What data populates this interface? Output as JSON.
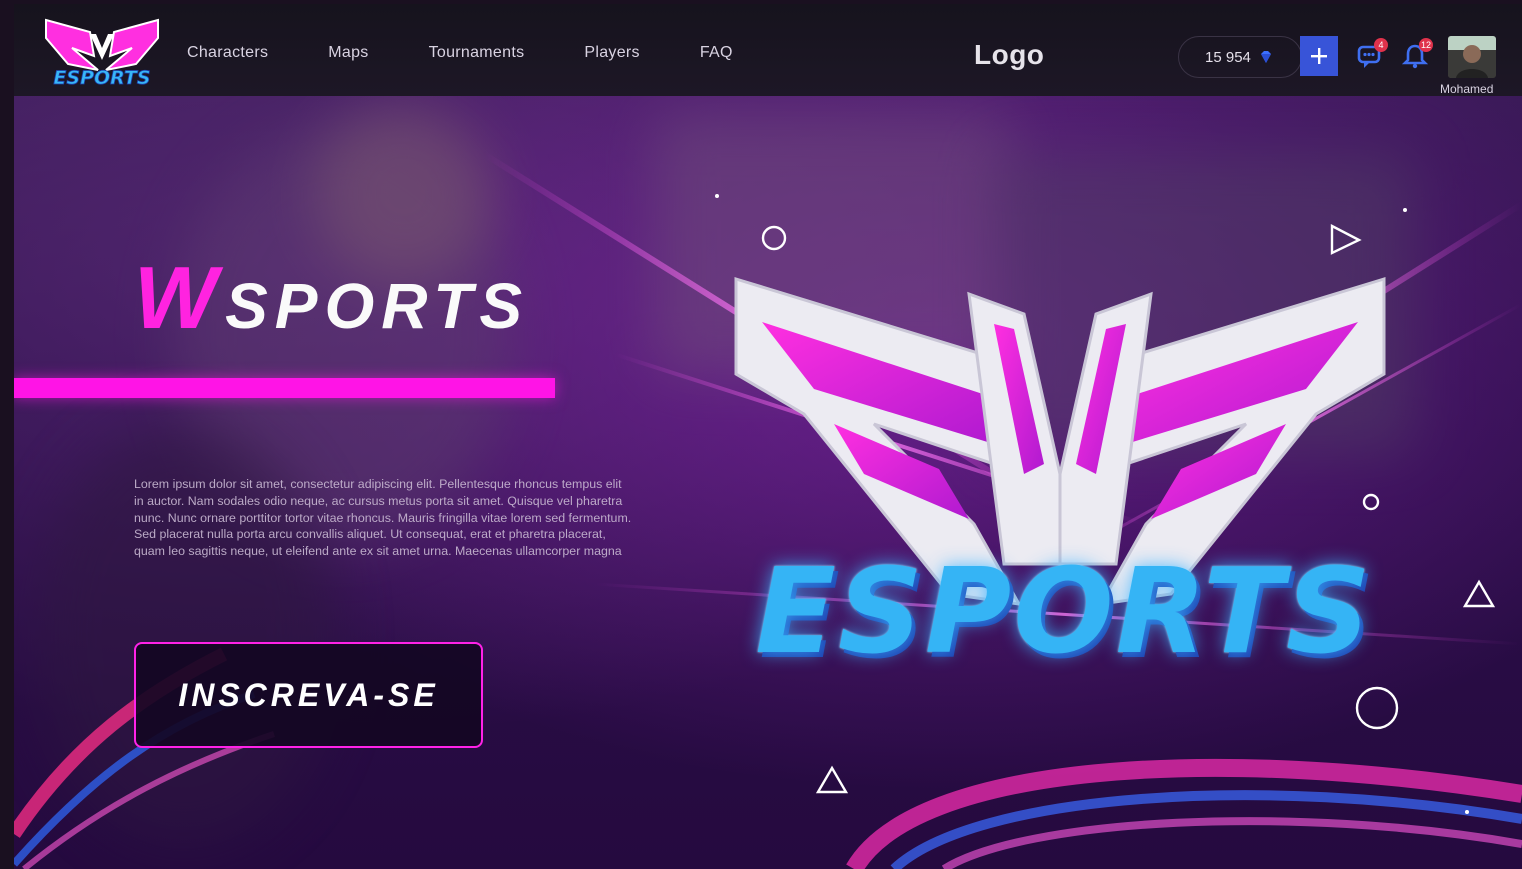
{
  "header": {
    "brand_logo_text": "ESPORTS",
    "nav_items": [
      {
        "label": "Characters"
      },
      {
        "label": "Maps"
      },
      {
        "label": "Tournaments"
      },
      {
        "label": "Players"
      },
      {
        "label": "FAQ"
      }
    ],
    "logo_text": "Logo",
    "wallet": {
      "amount": "15 954",
      "icon": "gem-icon"
    },
    "add_funds_icon": "plus-icon",
    "messages": {
      "icon": "chat-icon",
      "badge": "4"
    },
    "notifications": {
      "icon": "bell-icon",
      "badge": "12"
    },
    "user": {
      "name": "Mohamed"
    }
  },
  "hero": {
    "title_highlight": "W",
    "title_rest": "SPORTS",
    "description": "Lorem ipsum dolor sit amet, consectetur adipiscing elit. Pellentesque rhoncus tempus elit in auctor. Nam sodales odio neque, ac cursus metus porta sit amet. Quisque vel pharetra nunc. Nunc ornare porttitor tortor vitae rhoncus. Mauris fringilla vitae lorem sed fermentum. Sed placerat nulla porta arcu convallis aliquet. Ut consequat, erat et pharetra placerat, quam leo sagittis neque, ut eleifend ante ex sit amet urna. Maecenas ullamcorper magna",
    "cta_label": "INSCREVA-SE",
    "emblem_text": "ESPORTS"
  },
  "colors": {
    "accent_pink": "#ff14e6",
    "nav_background": "#17141e",
    "button_blue": "#3854d8",
    "badge_red": "#e0324b",
    "emblem_blue": "#2aa7f0"
  }
}
